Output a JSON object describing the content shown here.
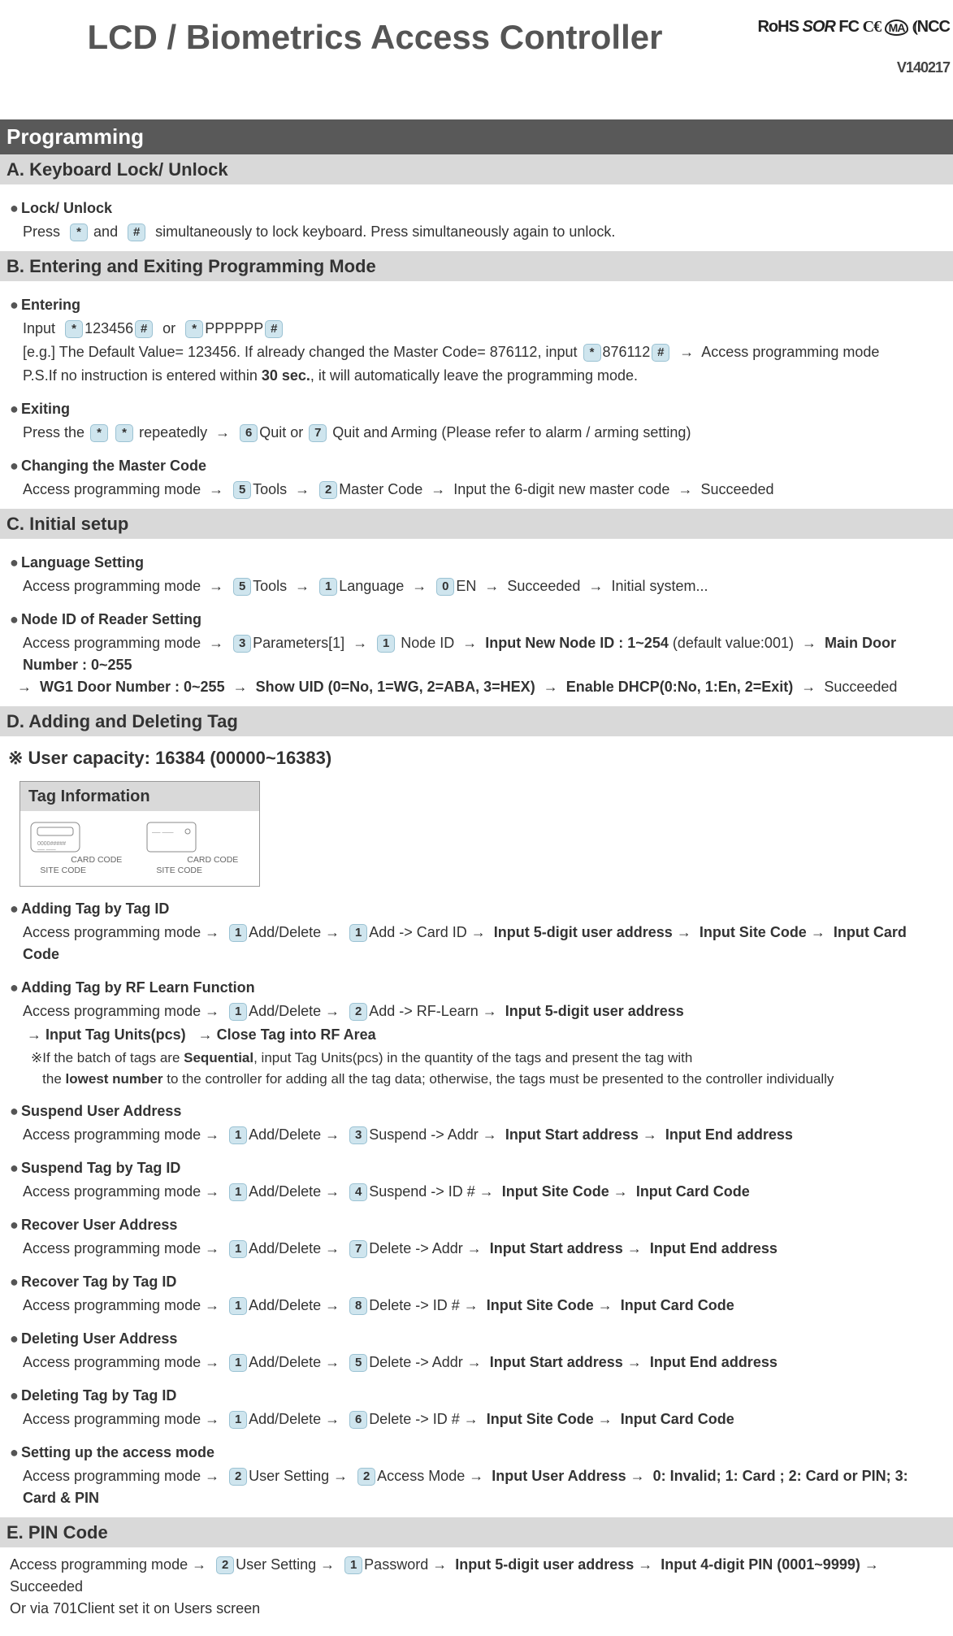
{
  "title": "LCD / Biometrics Access Controller",
  "version": "V140217",
  "logos": "RoHS SOR FCC CE MA NCC",
  "sections": {
    "programming": "Programming",
    "A": "A. Keyboard Lock/ Unlock",
    "B": "B. Entering and Exiting Programming Mode",
    "C": "C. Initial setup",
    "D": "D. Adding and Deleting Tag",
    "E": "E. PIN Code"
  },
  "A": {
    "lock_title": "Lock/ Unlock",
    "lock_press": "Press",
    "lock_and": "and",
    "lock_rest": "simultaneously to lock keyboard. Press simultaneously again to unlock."
  },
  "B": {
    "entering": "Entering",
    "input": "Input",
    "p1a": "123456",
    "or": "or",
    "p1b": "PPPPPP",
    "eg": "[e.g.] The Default Value= 123456. If already changed the Master Code= 876112, input",
    "eg_val": "876112",
    "eg_after": "Access programming mode",
    "ps": "P.S.If no instruction is entered within ",
    "ps_bold": "30 sec.",
    "ps_after": ", it will automatically leave the programming mode.",
    "exiting": "Exiting",
    "press_the": "Press the",
    "repeatedly": "repeatedly",
    "quit": "Quit or",
    "quit_arm": "Quit and Arming (Please refer to alarm / arming setting)",
    "changing": "Changing the Master Code",
    "access": "Access programming mode",
    "tools": "Tools",
    "master": "Master Code",
    "input_new": "Input the 6-digit new master code",
    "succeeded": "Succeeded"
  },
  "C": {
    "lang_title": "Language Setting",
    "access": "Access programming mode",
    "tools": "Tools",
    "language": "Language",
    "en": "EN",
    "succeeded": "Succeeded",
    "initial": "Initial system...",
    "node_title": "Node ID of Reader Setting",
    "params": "Parameters[1]",
    "nodeid": "Node ID",
    "input_new_node": "Input New Node ID : 1~254",
    "default": "(default value:001)",
    "main_door": "Main Door Number : 0~255",
    "wg1": "WG1 Door Number : 0~255",
    "show_uid": "Show UID (0=No, 1=WG, 2=ABA, 3=HEX)",
    "dhcp": "Enable DHCP(0:No, 1:En, 2=Exit)"
  },
  "D": {
    "capacity": "※ User capacity: 16384 (00000~16383)",
    "tag_info": "Tag Information",
    "card_code": "CARD CODE",
    "site_code": "SITE CODE",
    "add_by_id": "Adding Tag by Tag ID",
    "access": "Access programming mode",
    "add_delete": "Add/Delete",
    "add_card": "Add -> Card ID",
    "input_5": "Input 5-digit user address",
    "input_site": "Input Site Code",
    "input_card": "Input Card Code",
    "add_by_rf": "Adding Tag by RF Learn Function",
    "add_rf": "Add -> RF-Learn",
    "input_units": "Input Tag Units(pcs)",
    "close_tag": "Close Tag into RF Area",
    "rf_note1": "※If the batch of tags are ",
    "rf_seq": "Sequential",
    "rf_note2": ", input Tag Units(pcs) in the quantity of the tags and present the tag with",
    "rf_note3": "the ",
    "rf_lowest": "lowest number",
    "rf_note4": " to the controller for adding all the tag data; otherwise, the tags must be presented to the controller individually",
    "suspend_addr": "Suspend User Address",
    "suspend_addr_m": "Suspend -> Addr",
    "start_addr": "Input Start address",
    "end_addr": "Input End address",
    "suspend_id": "Suspend Tag by Tag ID",
    "suspend_id_m": "Suspend -> ID #",
    "recover_addr": "Recover User Address",
    "delete_addr": "Delete -> Addr",
    "recover_id": "Recover Tag by Tag ID",
    "delete_id": "Delete -> ID #",
    "deleting_addr": "Deleting User Address",
    "deleting_id": "Deleting Tag by Tag ID",
    "access_mode": "Setting up the access mode",
    "user_setting": "User Setting",
    "access_mode_m": "Access Mode",
    "input_user_addr": "Input User Address",
    "modes": "0: Invalid; 1: Card ; 2: Card or PIN; 3: Card & PIN"
  },
  "E": {
    "access": "Access programming mode",
    "user_setting": "User Setting",
    "password": "Password",
    "input_5": "Input 5-digit user address",
    "input_pin": "Input 4-digit PIN (0001~9999)",
    "succeeded": "Succeeded",
    "or_via": "Or via 701Client set it on  Users  screen"
  },
  "keys": {
    "star": "*",
    "hash": "#",
    "0": "0",
    "1": "1",
    "2": "2",
    "3": "3",
    "4": "4",
    "5": "5",
    "6": "6",
    "7": "7",
    "8": "8"
  },
  "arrow": "→"
}
